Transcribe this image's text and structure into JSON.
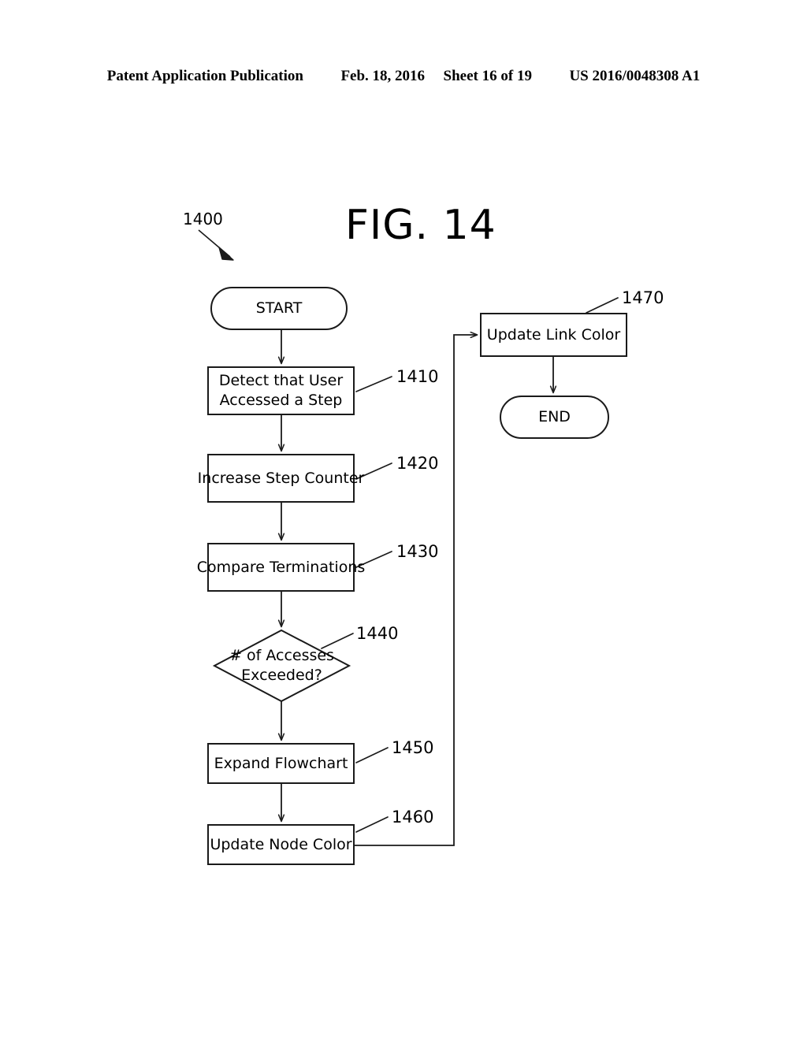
{
  "header": {
    "publication": "Patent Application Publication",
    "date": "Feb. 18, 2016",
    "sheet": "Sheet 16 of 19",
    "document_number": "US 2016/0048308 A1"
  },
  "figure": {
    "title": "FIG. 14",
    "reference_numeral": "1400"
  },
  "flowchart": {
    "nodes": [
      {
        "id": "start",
        "shape": "stadium",
        "label": "START",
        "ref": ""
      },
      {
        "id": "detect-step",
        "shape": "rect",
        "label": "Detect that User\nAccessed a Step",
        "ref": "1410"
      },
      {
        "id": "increase-counter",
        "shape": "rect",
        "label": "Increase Step Counter",
        "ref": "1420"
      },
      {
        "id": "compare-term",
        "shape": "rect",
        "label": "Compare Terminations",
        "ref": "1430"
      },
      {
        "id": "accesses-exceeded",
        "shape": "diamond",
        "label": "# of Accesses\nExceeded?",
        "ref": "1440"
      },
      {
        "id": "expand-flowchart",
        "shape": "rect",
        "label": "Expand Flowchart",
        "ref": "1450"
      },
      {
        "id": "update-node-color",
        "shape": "rect",
        "label": "Update Node Color",
        "ref": "1460"
      },
      {
        "id": "update-link-color",
        "shape": "rect",
        "label": "Update Link Color",
        "ref": "1470"
      },
      {
        "id": "end",
        "shape": "stadium",
        "label": "END",
        "ref": ""
      }
    ]
  },
  "style": {
    "stroke": "#1a1a1a",
    "background": "#ffffff"
  }
}
